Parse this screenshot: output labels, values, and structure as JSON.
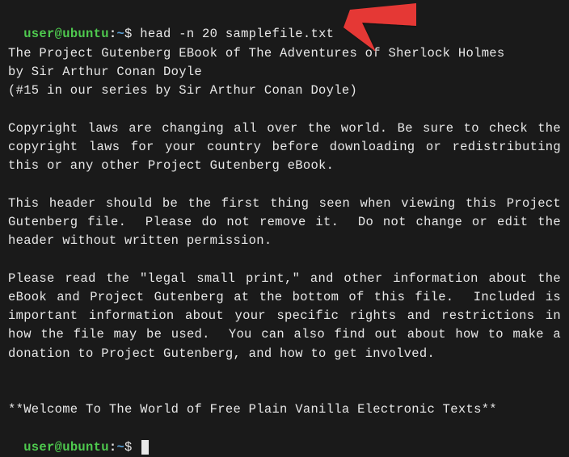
{
  "prompt1": {
    "user": "user",
    "at": "@",
    "host": "ubuntu",
    "colon": ":",
    "path": "~",
    "dollar": "$ ",
    "command": "head -n 20 samplefile.txt"
  },
  "output": {
    "l1": "The Project Gutenberg EBook of The Adventures of Sherlock Holmes",
    "l2": "by Sir Arthur Conan Doyle",
    "l3": "(#15 in our series by Sir Arthur Conan Doyle)",
    "l4": "Copyright laws are changing all over the world. Be sure to check the copyright laws for your country before downloading or redistributing this or any other Project Gutenberg eBook.",
    "l5": "This header should be the first thing seen when viewing this Project Gutenberg file.  Please do not remove it.  Do not change or edit the header without written permission.",
    "l6": "Please read the \"legal small print,\" and other information about the eBook and Project Gutenberg at the bottom of this file.  Included is important information about your specific rights and restrictions in how the file may be used.  You can also find out about how to make a donation to Project Gutenberg, and how to get involved.",
    "l7": "**Welcome To The World of Free Plain Vanilla Electronic Texts**"
  },
  "prompt2": {
    "user": "user",
    "at": "@",
    "host": "ubuntu",
    "colon": ":",
    "path": "~",
    "dollar": "$ "
  }
}
